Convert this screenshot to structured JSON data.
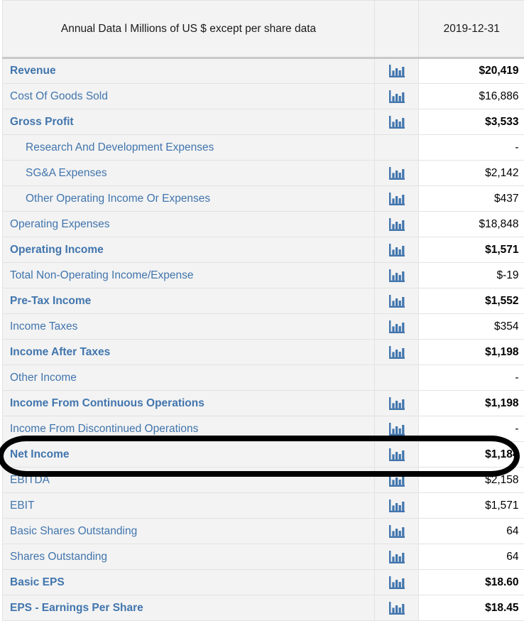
{
  "table": {
    "header": {
      "label": "Annual Data l Millions of US $ except per share data",
      "chart_col": "",
      "period": "2019-12-31"
    },
    "colors": {
      "link_blue": "#4175ad",
      "row_bg": "#f3f3f3",
      "value_bg": "#ffffff",
      "border": "#e2e2e2",
      "header_rule": "#c9c9c9",
      "annotation": "#000000"
    },
    "icon_name": "bar-chart-icon",
    "rows": [
      {
        "label": "Revenue",
        "value": "$20,419",
        "bold": true,
        "indent": false,
        "chart": true
      },
      {
        "label": "Cost Of Goods Sold",
        "value": "$16,886",
        "bold": false,
        "indent": false,
        "chart": true
      },
      {
        "label": "Gross Profit",
        "value": "$3,533",
        "bold": true,
        "indent": false,
        "chart": true
      },
      {
        "label": "Research And Development Expenses",
        "value": "-",
        "bold": false,
        "indent": true,
        "chart": false
      },
      {
        "label": "SG&A Expenses",
        "value": "$2,142",
        "bold": false,
        "indent": true,
        "chart": true
      },
      {
        "label": "Other Operating Income Or Expenses",
        "value": "$437",
        "bold": false,
        "indent": true,
        "chart": true
      },
      {
        "label": "Operating Expenses",
        "value": "$18,848",
        "bold": false,
        "indent": false,
        "chart": true
      },
      {
        "label": "Operating Income",
        "value": "$1,571",
        "bold": true,
        "indent": false,
        "chart": true
      },
      {
        "label": "Total Non-Operating Income/Expense",
        "value": "$-19",
        "bold": false,
        "indent": false,
        "chart": true
      },
      {
        "label": "Pre-Tax Income",
        "value": "$1,552",
        "bold": true,
        "indent": false,
        "chart": true
      },
      {
        "label": "Income Taxes",
        "value": "$354",
        "bold": false,
        "indent": false,
        "chart": true
      },
      {
        "label": "Income After Taxes",
        "value": "$1,198",
        "bold": true,
        "indent": false,
        "chart": true
      },
      {
        "label": "Other Income",
        "value": "-",
        "bold": false,
        "indent": false,
        "chart": false
      },
      {
        "label": "Income From Continuous Operations",
        "value": "$1,198",
        "bold": true,
        "indent": false,
        "chart": true
      },
      {
        "label": "Income From Discontinued Operations",
        "value": "-",
        "bold": false,
        "indent": false,
        "chart": true
      },
      {
        "label": "Net Income",
        "value": "$1,184",
        "bold": true,
        "indent": false,
        "chart": true
      },
      {
        "label": "EBITDA",
        "value": "$2,158",
        "bold": false,
        "indent": false,
        "chart": true
      },
      {
        "label": "EBIT",
        "value": "$1,571",
        "bold": false,
        "indent": false,
        "chart": true
      },
      {
        "label": "Basic Shares Outstanding",
        "value": "64",
        "bold": false,
        "indent": false,
        "chart": true
      },
      {
        "label": "Shares Outstanding",
        "value": "64",
        "bold": false,
        "indent": false,
        "chart": true
      },
      {
        "label": "Basic EPS",
        "value": "$18.60",
        "bold": true,
        "indent": false,
        "chart": true
      },
      {
        "label": "EPS - Earnings Per Share",
        "value": "$18.45",
        "bold": true,
        "indent": false,
        "chart": true
      }
    ]
  },
  "annotation": {
    "name": "net-income-highlight-ellipse",
    "target_row_label": "Net Income"
  }
}
